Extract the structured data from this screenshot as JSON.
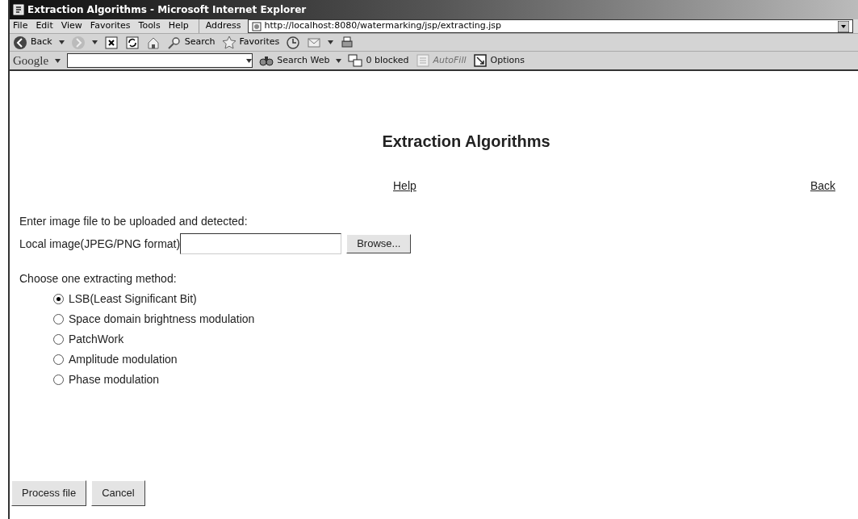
{
  "window": {
    "title": "Extraction Algorithms - Microsoft Internet Explorer"
  },
  "menu": [
    "File",
    "Edit",
    "View",
    "Favorites",
    "Tools",
    "Help"
  ],
  "address": {
    "label": "Address",
    "url": "http://localhost:8080/watermarking/jsp/extracting.jsp"
  },
  "toolbar": [
    {
      "kind": "back",
      "label": "Back"
    },
    {
      "kind": "forward"
    },
    {
      "kind": "stop"
    },
    {
      "kind": "refresh"
    },
    {
      "kind": "home"
    },
    {
      "kind": "search",
      "label": "Search"
    },
    {
      "kind": "favorites",
      "label": "Favorites"
    },
    {
      "kind": "history"
    },
    {
      "kind": "mail"
    },
    {
      "kind": "print"
    }
  ],
  "google_bar": {
    "logo": "Google",
    "items": [
      {
        "kind": "search_web",
        "label": "Search Web",
        "disabled": false
      },
      {
        "kind": "popup",
        "label": "0 blocked",
        "disabled": false
      },
      {
        "kind": "autofill",
        "label": "AutoFill",
        "disabled": true
      },
      {
        "kind": "options",
        "label": "Options",
        "disabled": false
      }
    ]
  },
  "page": {
    "heading": "Extraction Algorithms",
    "links": [
      "Help",
      "Back"
    ],
    "upload_prompt": "Enter image file to be uploaded and detected:",
    "file_label": "Local image(JPEG/PNG format)",
    "browse_button": "Browse...",
    "method_prompt": "Choose one extracting method:",
    "methods": [
      {
        "label": "LSB(Least Significant Bit)",
        "selected": true
      },
      {
        "label": "Space domain brightness modulation",
        "selected": false
      },
      {
        "label": "PatchWork",
        "selected": false
      },
      {
        "label": "Amplitude modulation",
        "selected": false
      },
      {
        "label": "Phase modulation",
        "selected": false
      }
    ],
    "buttons": [
      "Process file",
      "Cancel"
    ]
  }
}
